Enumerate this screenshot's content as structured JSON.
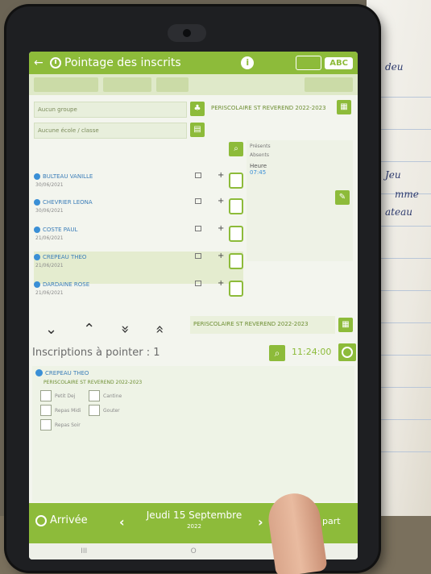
{
  "app": {
    "title": "Pointage des inscrits",
    "info_icon": "i",
    "abc_label": "ABC"
  },
  "filters": {
    "group_field": "Aucun groupe",
    "school_field": "Aucune école / classe",
    "periscolaire_top": "PERISCOLAIRE ST REVEREND 2022-2023"
  },
  "students": [
    {
      "name": "BULTEAU VANILLE",
      "date": "30/06/2021"
    },
    {
      "name": "CHEVRIER LEONA",
      "date": "30/06/2021"
    },
    {
      "name": "COSTE PAUL",
      "date": "21/06/2021"
    },
    {
      "name": "CREPEAU THEO",
      "date": "21/06/2021"
    },
    {
      "name": "DARDAINE ROSE",
      "date": "21/06/2021"
    }
  ],
  "right_panel": {
    "presents": "Présents",
    "absents": "Absents",
    "heure_label": "Heure",
    "heure_value": "07:45"
  },
  "nav": {
    "chev_down": "⌄",
    "chev_up": "⌃",
    "dbl_down": "»",
    "dbl_up": "«",
    "periscolaire_bottom": "PERISCOLAIRE ST REVEREND 2022-2023"
  },
  "inscriptions": {
    "title": "Inscriptions à pointer : 1",
    "time": "11:24:00",
    "card_name": "CREPEAU THEO",
    "card_sub": "PERISCOLAIRE ST REVEREND 2022-2023",
    "options": [
      "Petit Dej",
      "Cantine",
      "Repas Midi",
      "Gouter",
      "Repas Soir"
    ]
  },
  "footer": {
    "arrivee": "Arrivée",
    "prev": "‹",
    "next": "›",
    "date": "Jeudi 15 Septembre",
    "year": "2022",
    "depart": "part"
  },
  "sysbar": {
    "recents": "III",
    "home": "O",
    "back": "<"
  },
  "notes": {
    "line1": "deu",
    "line2": "Jeu",
    "line3": "mme",
    "line4": "ateau"
  },
  "colors": {
    "accent": "#8dbb3a",
    "name_blue": "#3a7db8"
  }
}
